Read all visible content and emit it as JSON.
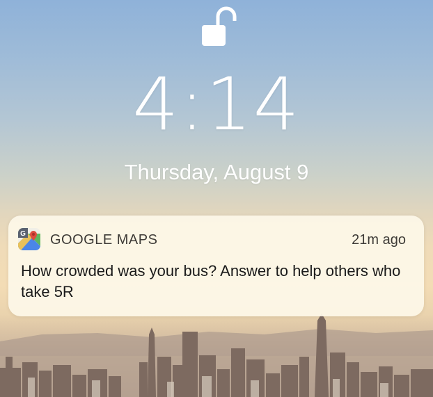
{
  "lock_screen": {
    "lock_icon": "unlocked-padlock-icon",
    "time": "4:14",
    "date": "Thursday, August 9"
  },
  "notification": {
    "app_icon": "google-maps-icon",
    "app_name": "GOOGLE MAPS",
    "timestamp": "21m ago",
    "message": "How crowded was your bus? Answer to help others who take 5R"
  },
  "colors": {
    "text_on_wallpaper": "#ffffff",
    "notification_background": "#fdf7e8",
    "notification_text": "#1a1a1a",
    "notification_meta_text": "#3e3b37"
  }
}
